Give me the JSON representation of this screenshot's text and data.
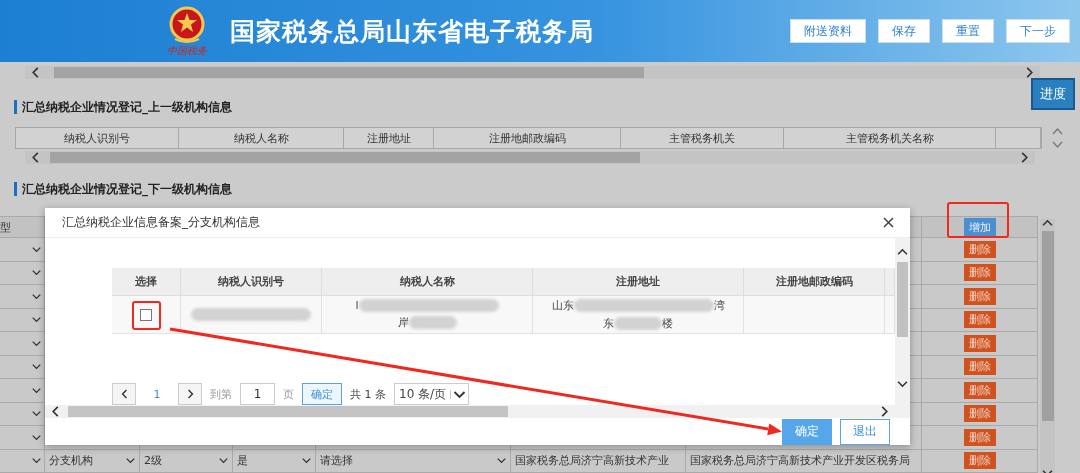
{
  "header": {
    "logo_caption": "中国税务",
    "title": "国家税务总局山东省电子税务局",
    "buttons": [
      "附送资料",
      "保存",
      "重置",
      "下一步"
    ]
  },
  "progress_button": "进度",
  "upper_section": {
    "title": "汇总纳税企业情况登记_上一级机构信息",
    "columns": [
      "纳税人识别号",
      "纳税人名称",
      "注册地址",
      "注册地邮政编码",
      "主管税务机关",
      "主管税务机关名称"
    ]
  },
  "lower_section": {
    "title": "汇总纳税企业情况登记_下一级机构信息",
    "column_1": "型",
    "add_button": "增加",
    "rows": [
      {
        "delete_button": "删除"
      },
      {
        "delete_button": "删除"
      },
      {
        "delete_button": "删除"
      },
      {
        "delete_button": "删除"
      },
      {
        "delete_button": "删除"
      },
      {
        "delete_button": "删除"
      },
      {
        "delete_button": "删除"
      },
      {
        "delete_button": "删除"
      },
      {
        "delete_button": "删除"
      },
      {
        "delete_button": "删除",
        "cells": [
          {
            "kind": "select",
            "text": "分支机构"
          },
          {
            "kind": "select",
            "text": "2级"
          },
          {
            "kind": "select",
            "text": "是"
          },
          {
            "kind": "select",
            "text": "请选择"
          },
          {
            "kind": "text",
            "text": "国家税务总局济宁高新技术产业"
          },
          {
            "kind": "text",
            "text": "国家税务总局济宁高新技术产业开发区税务局"
          }
        ]
      }
    ]
  },
  "dialog": {
    "title": "汇总纳税企业信息备案_分支机构信息",
    "table": {
      "columns": [
        "选择",
        "纳税人识别号",
        "纳税人名称",
        "注册地址",
        "注册地邮政编码"
      ],
      "rows": [
        {
          "cells": [
            {
              "kind": "checkbox",
              "checked": false
            },
            {
              "kind": "redacted"
            },
            {
              "kind": "lines",
              "lines": [
                {
                  "before": "l"
                },
                {
                  "before": "岸"
                }
              ]
            },
            {
              "kind": "lines",
              "lines": [
                {
                  "before": "山东",
                  "after": "湾"
                },
                {
                  "before": "东",
                  "after": "楼"
                }
              ]
            }
          ]
        }
      ]
    },
    "pager": {
      "page": "1",
      "goto_label": "到第",
      "goto_value": "1",
      "page_unit": "页",
      "go_button": "确定",
      "total": "共 1 条",
      "page_size": "10 条/页"
    },
    "buttons": [
      {
        "label": "确定",
        "kind": "primary"
      },
      {
        "label": "退出",
        "kind": "secondary"
      }
    ]
  }
}
